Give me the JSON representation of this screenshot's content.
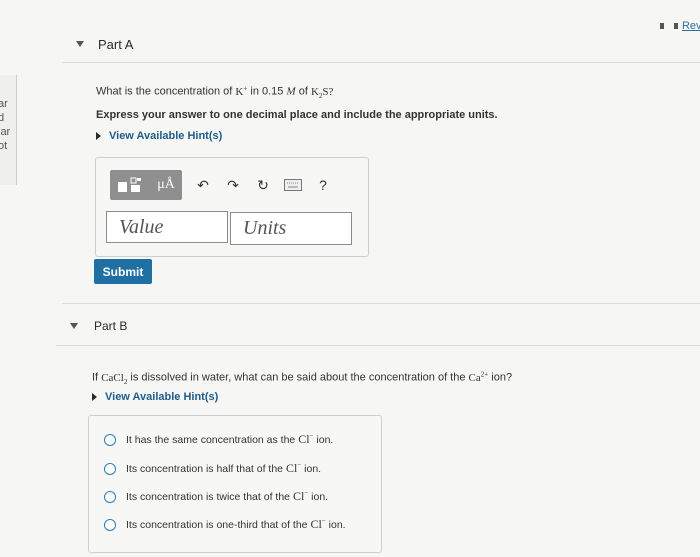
{
  "review_link": "Revi",
  "left_fragments": [
    "ar",
    "d",
    "lar",
    "ot"
  ],
  "part_a": {
    "title": "Part A",
    "question_prefix": "What is the concentration of",
    "question_k": "K",
    "question_k_sup": "+",
    "question_mid": "in 0.15",
    "question_M": "M",
    "question_of": "of",
    "question_k2s": "K",
    "question_k2s_sub": "2",
    "question_k2s_s": "S?",
    "instruction": "Express your answer to one decimal place and include the appropriate units.",
    "hint": "View Available Hint(s)",
    "toolbar": {
      "mu_label": "μÅ",
      "help": "?"
    },
    "value_placeholder": "Value",
    "units_placeholder": "Units",
    "submit": "Submit"
  },
  "part_b": {
    "title": "Part B",
    "question_prefix": "If",
    "ca": "CaCl",
    "ca_sub": "2",
    "question_mid": "is dissolved in water, what can be said about the concentration of the",
    "ion": "Ca",
    "ion_sup": "2+",
    "question_end": "ion?",
    "hint": "View Available Hint(s)",
    "options": [
      {
        "before": "It has the same concentration as the",
        "cl": "Cl",
        "sup": "−",
        "after": "ion."
      },
      {
        "before": "Its concentration is half that of the",
        "cl": "Cl",
        "sup": "−",
        "after": "ion."
      },
      {
        "before": "Its concentration is twice that of the",
        "cl": "Cl",
        "sup": "−",
        "after": "ion."
      },
      {
        "before": "Its concentration is one-third that of the",
        "cl": "Cl",
        "sup": "−",
        "after": "ion."
      }
    ]
  }
}
